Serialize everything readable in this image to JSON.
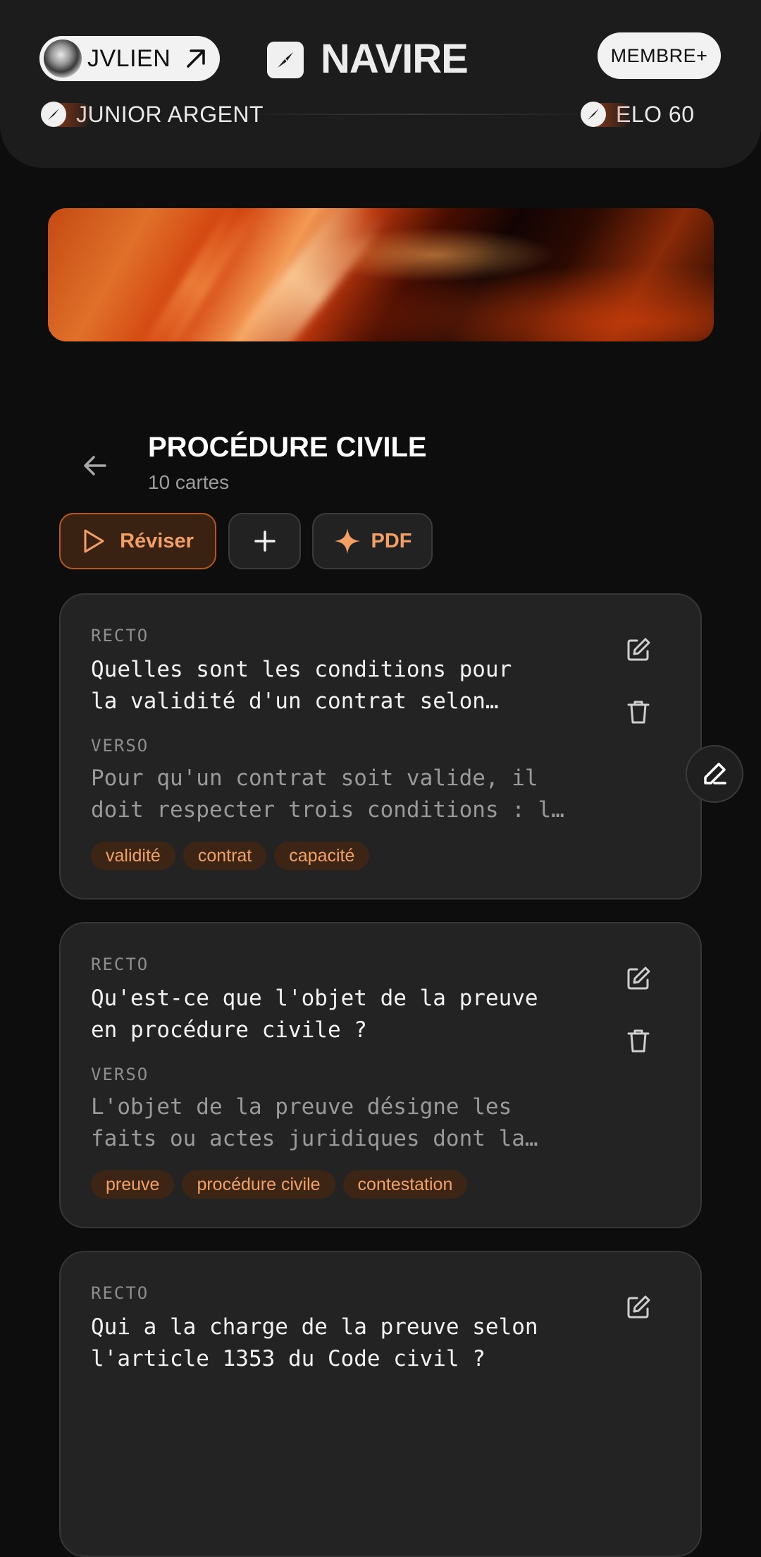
{
  "header": {
    "user": {
      "name": "JVLIEN"
    },
    "app_title": "NAVIRE",
    "member_button": "MEMBRE+",
    "rank": "JUNIOR ARGENT",
    "elo": "ELO 60"
  },
  "deck": {
    "title": "PROCÉDURE CIVILE",
    "count": "10 cartes",
    "actions": {
      "review": "Réviser",
      "pdf": "PDF"
    }
  },
  "cards": [
    {
      "front_label": "RECTO",
      "front_lines": [
        "Quelles sont les conditions pour",
        "la validité d'un contrat selon…"
      ],
      "back_label": "VERSO",
      "back_lines": [
        "Pour qu'un contrat soit valide, il",
        "doit respecter trois conditions : l…"
      ],
      "tags": [
        "validité",
        "contrat",
        "capacité"
      ]
    },
    {
      "front_label": "RECTO",
      "front_lines": [
        "Qu'est-ce que l'objet de la preuve",
        "en procédure civile ?"
      ],
      "back_label": "VERSO",
      "back_lines": [
        "L'objet de la preuve désigne les",
        "faits ou actes juridiques dont la…"
      ],
      "tags": [
        "preuve",
        "procédure civile",
        "contestation"
      ]
    },
    {
      "front_label": "RECTO",
      "front_lines": [
        "Qui a la charge de la preuve selon",
        "l'article 1353 du Code civil ?"
      ]
    }
  ],
  "icons": {
    "user_link": "arrow-up-right-icon",
    "logo": "compass-needle-icon",
    "back": "arrow-left-icon",
    "review": "play-icon",
    "add": "plus-icon",
    "pdf": "sparkle-icon",
    "edit": "edit-icon",
    "delete": "trash-icon",
    "floating": "pencil-icon"
  },
  "colors": {
    "background": "#0d0d0d",
    "header": "#1c1c1c",
    "card": "#232323",
    "accent": "#f2a066",
    "tag_background": "#3d2516"
  }
}
